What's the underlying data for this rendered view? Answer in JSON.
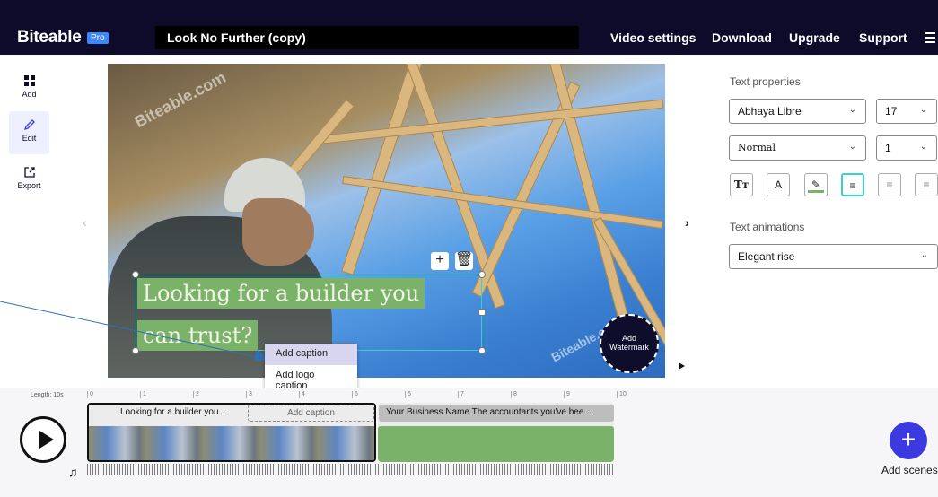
{
  "app": {
    "logo": "Biteable",
    "plan_badge": "Pro",
    "project_title": "Look No Further (copy)"
  },
  "nav": {
    "video_settings": "Video settings",
    "download": "Download",
    "upgrade": "Upgrade",
    "support": "Support"
  },
  "sidebar": {
    "add": "Add",
    "edit": "Edit",
    "export": "Export"
  },
  "canvas": {
    "caption_line1": "Looking for a builder you",
    "caption_line2": "can trust?",
    "watermark_label_1": "Add",
    "watermark_label_2": "Watermark",
    "bg_watermark": "Biteable.com"
  },
  "popup": {
    "add_caption": "Add caption",
    "add_logo_caption": "Add logo caption"
  },
  "text_panel": {
    "heading": "Text properties",
    "font": "Abhaya Libre",
    "size": "17",
    "weight": "Normal",
    "line_height": "1",
    "animations_heading": "Text animations",
    "animation": "Elegant rise"
  },
  "timeline": {
    "length_label": "Length: 10s",
    "ticks": [
      "0",
      "1",
      "2",
      "3",
      "4",
      "5",
      "6",
      "7",
      "8",
      "9",
      "10"
    ],
    "scene1_caption": "Looking for a builder you...",
    "scene1_add_caption": "Add caption",
    "scene2_caption": "Your Business Name The accountants you've bee...",
    "add_scenes": "Add scenes"
  },
  "colors": {
    "topbar": "#0e0b2a",
    "accent": "#3b3ae0",
    "caption_bg": "#7ab26a",
    "selection": "#3ad1c4"
  }
}
